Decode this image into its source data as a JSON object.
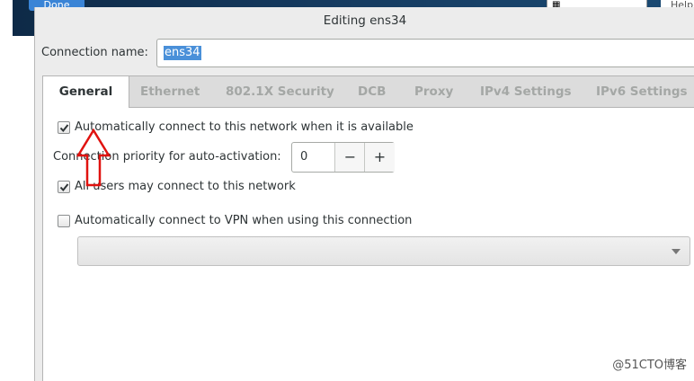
{
  "background": {
    "done_button": "Done",
    "help_button": "Help"
  },
  "dialog": {
    "title": "Editing ens34",
    "connection_name_label": "Connection name:",
    "connection_name_value": "ens34"
  },
  "tabs": [
    {
      "label": "General",
      "active": true
    },
    {
      "label": "Ethernet",
      "active": false
    },
    {
      "label": "802.1X Security",
      "active": false
    },
    {
      "label": "DCB",
      "active": false
    },
    {
      "label": "Proxy",
      "active": false
    },
    {
      "label": "IPv4 Settings",
      "active": false
    },
    {
      "label": "IPv6 Settings",
      "active": false
    }
  ],
  "general": {
    "auto_connect_label": "Automatically connect to this network when it is available",
    "auto_connect_checked": true,
    "priority_label": "Connection priority for auto-activation:",
    "priority_value": "0",
    "priority_decrement": "−",
    "priority_increment": "+",
    "all_users_label": "All users may connect to this network",
    "all_users_checked": true,
    "vpn_label": "Automatically connect to VPN when using this connection",
    "vpn_checked": false,
    "vpn_selected": ""
  },
  "annotation": {
    "arrow_color": "#e0120f"
  },
  "watermark": "@51CTO博客"
}
